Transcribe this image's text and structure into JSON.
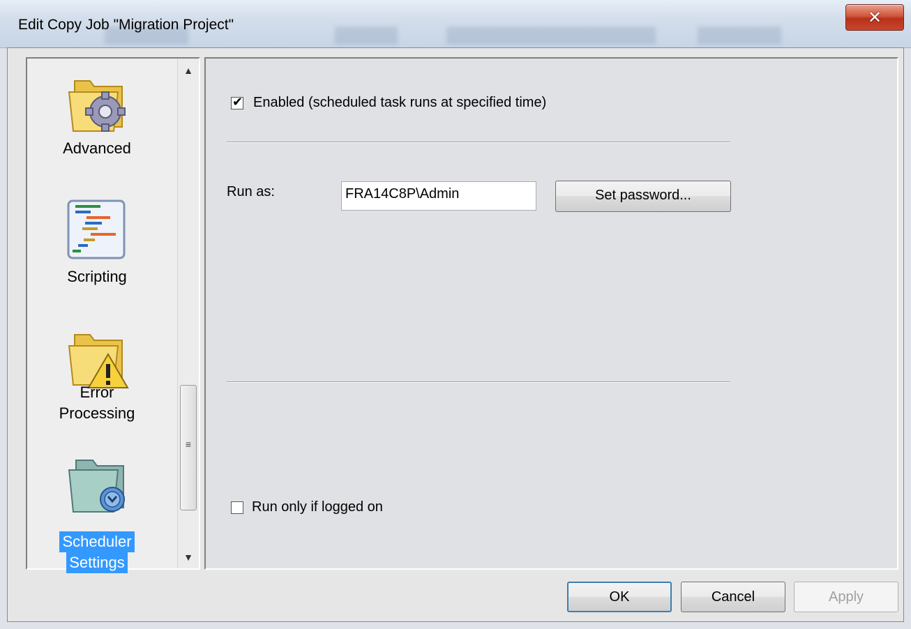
{
  "window": {
    "title": "Edit Copy Job \"Migration Project\"",
    "close_glyph": "✕"
  },
  "sidebar": {
    "items": [
      {
        "label": "Advanced",
        "icon": "folder-gear-icon"
      },
      {
        "label": "Scripting",
        "icon": "script-icon"
      },
      {
        "label_line1": "Error",
        "label_line2": "Processing",
        "icon": "folder-warning-icon"
      },
      {
        "label_line1": "Scheduler",
        "label_line2": "Settings",
        "icon": "folder-scheduler-icon",
        "selected": true
      }
    ],
    "scroll_up": "▲",
    "scroll_down": "▼",
    "scroll_grip": "≡"
  },
  "panel": {
    "enabled_checked": true,
    "enabled_label": "Enabled (scheduled task runs at specified time)",
    "run_as_label": "Run as:",
    "run_as_value": "FRA14C8P\\Admin",
    "set_password_label": "Set password...",
    "run_only_logged_on_checked": false,
    "run_only_logged_on_label": "Run only if logged on"
  },
  "footer": {
    "ok_label": "OK",
    "cancel_label": "Cancel",
    "apply_label": "Apply"
  },
  "colors": {
    "selection": "#3399ff",
    "close_button": "#c9452c"
  }
}
